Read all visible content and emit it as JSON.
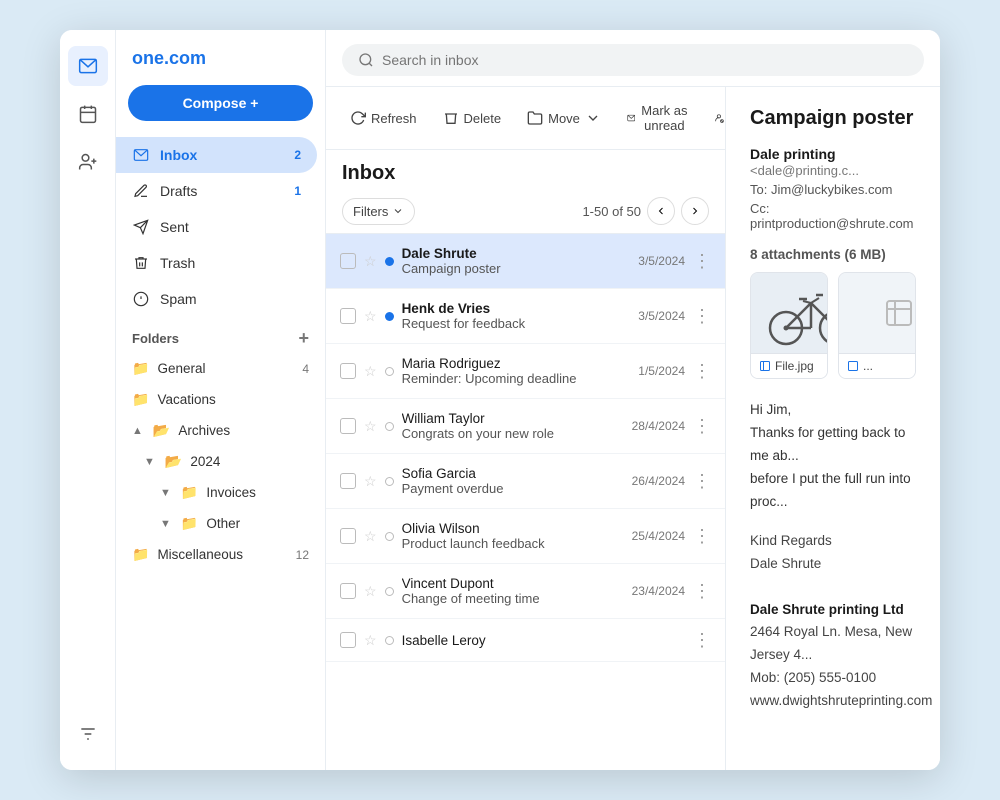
{
  "app": {
    "logo": "one.com",
    "bg_color": "#daeaf5"
  },
  "icon_rail": {
    "items": [
      {
        "name": "mail-icon",
        "label": "Mail",
        "active": true,
        "unicode": "✉"
      },
      {
        "name": "calendar-icon",
        "label": "Calendar",
        "active": false,
        "unicode": "📅"
      },
      {
        "name": "contacts-icon",
        "label": "Contacts",
        "active": false,
        "unicode": "👥"
      },
      {
        "name": "settings-icon",
        "label": "Settings",
        "active": false,
        "unicode": "⚙"
      }
    ]
  },
  "sidebar": {
    "compose_label": "Compose +",
    "nav_items": [
      {
        "name": "inbox",
        "label": "Inbox",
        "count": 2,
        "active": true
      },
      {
        "name": "drafts",
        "label": "Drafts",
        "count": 1,
        "active": false
      },
      {
        "name": "sent",
        "label": "Sent",
        "count": null,
        "active": false
      },
      {
        "name": "trash",
        "label": "Trash",
        "count": null,
        "active": false
      },
      {
        "name": "spam",
        "label": "Spam",
        "count": null,
        "active": false
      }
    ],
    "folders_label": "Folders",
    "folders": [
      {
        "name": "general",
        "label": "General",
        "count": 4,
        "indent": 0,
        "expanded": false
      },
      {
        "name": "vacations",
        "label": "Vacations",
        "count": null,
        "indent": 0,
        "expanded": false
      },
      {
        "name": "archives",
        "label": "Archives",
        "count": null,
        "indent": 0,
        "expanded": true
      },
      {
        "name": "2024",
        "label": "2024",
        "count": null,
        "indent": 1,
        "expanded": true
      },
      {
        "name": "invoices",
        "label": "Invoices",
        "count": null,
        "indent": 2,
        "expanded": false
      },
      {
        "name": "other",
        "label": "Other",
        "count": null,
        "indent": 2,
        "expanded": false
      },
      {
        "name": "miscellaneous",
        "label": "Miscellaneous",
        "count": 12,
        "indent": 0,
        "expanded": false
      }
    ]
  },
  "toolbar": {
    "refresh_label": "Refresh",
    "delete_label": "Delete",
    "move_label": "Move",
    "mark_unread_label": "Mark as unread",
    "block_sender_label": "Block sender"
  },
  "email_list": {
    "title": "Inbox",
    "filters_label": "Filters",
    "pagination_text": "1-50 of 50",
    "emails": [
      {
        "sender": "Dale Shrute",
        "subject": "Campaign poster",
        "date": "3/5/2024",
        "unread": true,
        "selected": true
      },
      {
        "sender": "Henk de Vries",
        "subject": "Request for feedback",
        "date": "3/5/2024",
        "unread": true,
        "selected": false
      },
      {
        "sender": "Maria Rodriguez",
        "subject": "Reminder: Upcoming deadline",
        "date": "1/5/2024",
        "unread": false,
        "selected": false
      },
      {
        "sender": "William Taylor",
        "subject": "Congrats on your new role",
        "date": "28/4/2024",
        "unread": false,
        "selected": false
      },
      {
        "sender": "Sofia Garcia",
        "subject": "Payment overdue",
        "date": "26/4/2024",
        "unread": false,
        "selected": false
      },
      {
        "sender": "Olivia Wilson",
        "subject": "Product launch feedback",
        "date": "25/4/2024",
        "unread": false,
        "selected": false
      },
      {
        "sender": "Vincent Dupont",
        "subject": "Change of meeting time",
        "date": "23/4/2024",
        "unread": false,
        "selected": false
      },
      {
        "sender": "Isabelle Leroy",
        "subject": "",
        "date": "",
        "unread": false,
        "selected": false
      }
    ]
  },
  "email_detail": {
    "title": "Campaign poster",
    "sender_name": "Dale printing",
    "sender_email": "<dale@printing.c...",
    "to": "To: Jim@luckybikes.com",
    "cc": "Cc: printproduction@shrute.com",
    "attachments_label": "8 attachments (6 MB)",
    "attachment_1_label": "File.jpg",
    "body_greeting": "Hi Jim,",
    "body_line1": "Thanks for getting back to me ab...",
    "body_line2": "before I put the full run into proc...",
    "regards_label": "Kind Regards",
    "regards_name": "Dale Shrute",
    "sig_company": "Dale Shrute printing Ltd",
    "sig_address": "2464 Royal Ln. Mesa, New Jersey 4...",
    "sig_mob": "Mob: (205) 555-0100",
    "sig_web": "www.dwightshruteprinting.com"
  },
  "search": {
    "placeholder": "Search in inbox"
  }
}
